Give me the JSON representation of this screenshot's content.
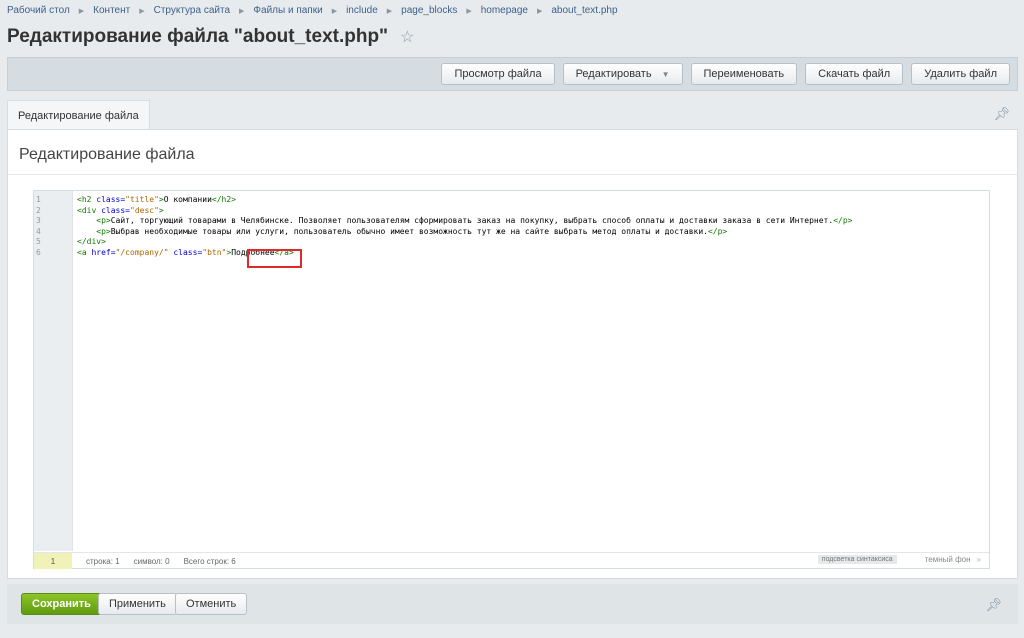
{
  "breadcrumb": [
    "Рабочий стол",
    "Контент",
    "Структура сайта",
    "Файлы и папки",
    "include",
    "page_blocks",
    "homepage",
    "about_text.php"
  ],
  "page": {
    "title": "Редактирование файла \"about_text.php\""
  },
  "icons": {
    "star": "star-icon",
    "pin": "pin-icon",
    "chevron": "chevron-right-icon",
    "caret": "caret-down-icon"
  },
  "toolbar": {
    "view_label": "Просмотр файла",
    "edit_label": "Редактировать",
    "rename_label": "Переименовать",
    "download_label": "Скачать файл",
    "delete_label": "Удалить файл"
  },
  "tabs": [
    {
      "label": "Редактирование файла"
    }
  ],
  "panel": {
    "title": "Редактирование файла"
  },
  "editor": {
    "line_numbers": [
      "1",
      "2",
      "3",
      "4",
      "5",
      "6"
    ],
    "lines": [
      [
        {
          "t": "tag",
          "v": "<h2 "
        },
        {
          "t": "attr",
          "v": "class="
        },
        {
          "t": "str",
          "v": "\"title\""
        },
        {
          "t": "tag",
          "v": ">"
        },
        {
          "t": "txt",
          "v": "О компании"
        },
        {
          "t": "tag",
          "v": "</h2>"
        }
      ],
      [
        {
          "t": "tag",
          "v": "<div "
        },
        {
          "t": "attr",
          "v": "class="
        },
        {
          "t": "str",
          "v": "\"desc\""
        },
        {
          "t": "tag",
          "v": ">"
        }
      ],
      [
        {
          "t": "txt",
          "v": "    "
        },
        {
          "t": "tag",
          "v": "<p>"
        },
        {
          "t": "txt",
          "v": "Сайт, торгующий товарами в Челябинске. Позволяет пользователям сформировать заказ на покупку, выбрать способ оплаты и доставки заказа в сети Интернет."
        },
        {
          "t": "tag",
          "v": "</p>"
        }
      ],
      [
        {
          "t": "txt",
          "v": "    "
        },
        {
          "t": "tag",
          "v": "<p>"
        },
        {
          "t": "txt",
          "v": "Выбрав необходимые товары или услуги, пользователь обычно имеет возможность тут же на сайте выбрать метод оплаты и доставки."
        },
        {
          "t": "tag",
          "v": "</p>"
        }
      ],
      [
        {
          "t": "tag",
          "v": "</div>"
        }
      ],
      [
        {
          "t": "tag",
          "v": "<a "
        },
        {
          "t": "attr",
          "v": "href="
        },
        {
          "t": "str",
          "v": "\"/company/\""
        },
        {
          "t": "txt",
          "v": " "
        },
        {
          "t": "attr",
          "v": "class="
        },
        {
          "t": "str",
          "v": "\"btn\""
        },
        {
          "t": "tag",
          "v": ">"
        },
        {
          "t": "txt",
          "v": "Подробнее"
        },
        {
          "t": "tag",
          "v": "</a>"
        }
      ]
    ],
    "status": {
      "current_line": "1",
      "line": "строка: 1",
      "symbol": "символ: 0",
      "total": "Всего строк: 6",
      "syntax_label": "подсветка синтаксиса",
      "dark_bg_label": "темный фон",
      "dark_bg_toggle": "»"
    }
  },
  "footer": {
    "save_label": "Сохранить",
    "apply_label": "Применить",
    "cancel_label": "Отменить"
  },
  "colors": {
    "save_green": "#6aa318",
    "highlight_red": "#e02a2a",
    "tag_green": "#117700",
    "attr_blue": "#0000cc",
    "string_orange": "#aa6600"
  }
}
